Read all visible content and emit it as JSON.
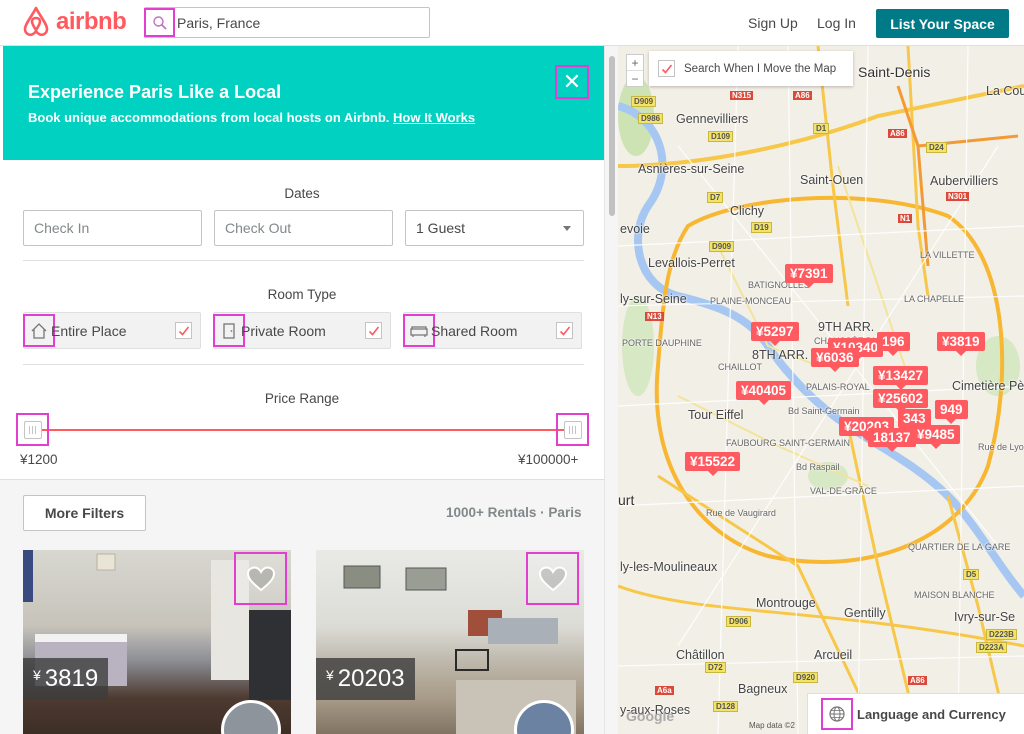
{
  "header": {
    "logo_text": "airbnb",
    "search_value": "Paris, France",
    "sign_up": "Sign Up",
    "log_in": "Log In",
    "list_space": "List Your Space"
  },
  "promo": {
    "title": "Experience Paris Like a Local",
    "subtitle": "Book unique accommodations from local hosts on Airbnb.",
    "link": "How It Works",
    "close": "✕"
  },
  "filters": {
    "dates_title": "Dates",
    "check_in_placeholder": "Check In",
    "check_out_placeholder": "Check Out",
    "guests": "1 Guest",
    "room_type_title": "Room Type",
    "rooms": [
      {
        "label": "Entire Place",
        "icon": "home-icon",
        "checked": true
      },
      {
        "label": "Private Room",
        "icon": "door-icon",
        "checked": true
      },
      {
        "label": "Shared Room",
        "icon": "couch-icon",
        "checked": true
      }
    ],
    "price_title": "Price Range",
    "price_min": "¥1200",
    "price_max": "¥100000+",
    "more_filters": "More Filters",
    "result_count": "1000+ Rentals · Paris"
  },
  "listings": [
    {
      "currency": "¥",
      "price": "3819"
    },
    {
      "currency": "¥",
      "price": "20203"
    }
  ],
  "map": {
    "zoom_in": "+",
    "zoom_out": "−",
    "search_when_move": "Search When I Move the Map",
    "language_currency": "Language and Currency",
    "google": "Google",
    "attribution": "Map data ©2",
    "pins": [
      "¥7391",
      "¥5297",
      "¥10340",
      "196",
      "¥6036",
      "¥3819",
      "¥13427",
      "¥40405",
      "¥25602",
      "¥20203",
      "343",
      "949",
      "18137",
      "¥9485",
      "¥15522"
    ],
    "places": [
      "Saint-Denis",
      "La Cou",
      "Gennevilliers",
      "Asnières-sur-Seine",
      "Saint-Ouen",
      "Aubervilliers",
      "Clichy",
      "evoie",
      "Levallois-Perret",
      "LA CHAPELLE",
      "ly-sur-Seine",
      "9TH ARR.",
      "8TH ARR.",
      "Cimetière Père",
      "Tour Eiffel",
      "VAL-DE-GRÂCE",
      "urt",
      "ly-les-Moulineaux",
      "Montrouge",
      "Gentilly",
      "Ivry-sur-Se",
      "Châtillon",
      "Bagneux",
      "Arcueil",
      "y-aux-Roses",
      "BATIGNOLLES",
      "PLAINE-MONCEAU",
      "CHAILLOT",
      "PALAIS-ROYAL",
      "FAUBOURG SAINT-GERMAIN",
      "QUARTIER DE LA GARE",
      "PORTE DAUPHINE",
      "LA VILLETTE",
      "MAISON BLANCHE",
      "CHAUSSÉE D'ANTIN",
      "Rue de Vaugirard",
      "Bd Raspail",
      "Bd Saint-Germain",
      "Rue de Lyon"
    ],
    "roads": [
      "N315",
      "A86",
      "D909",
      "D986",
      "D109",
      "D1",
      "D7",
      "D19",
      "D909",
      "N1",
      "A86",
      "D24",
      "N301",
      "N13",
      "D906",
      "D72",
      "D128",
      "A6a",
      "D920",
      "D223B",
      "D223A",
      "A86",
      "D5"
    ]
  }
}
